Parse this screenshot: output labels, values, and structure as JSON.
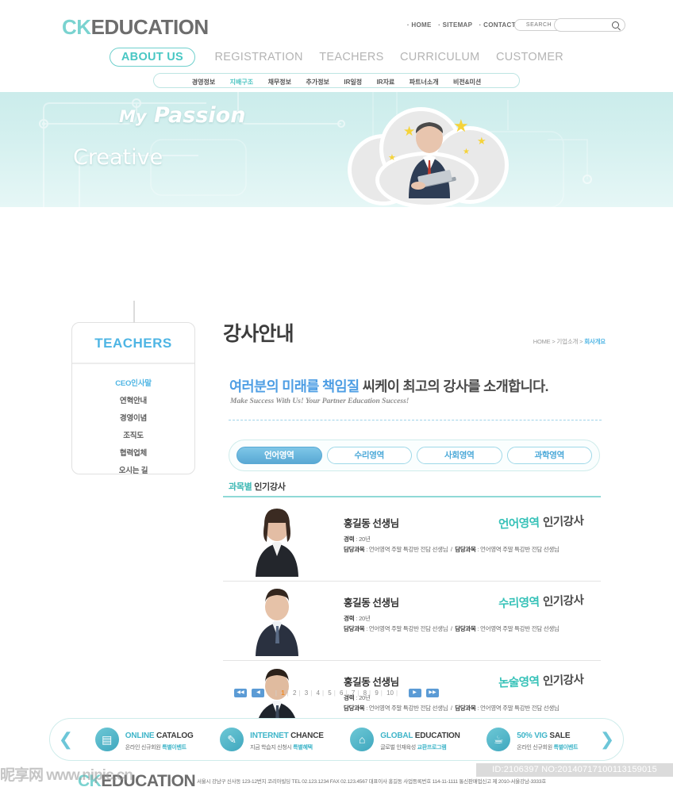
{
  "header": {
    "logo_ck": "CK",
    "logo_education": "EDUCATION",
    "top_links": [
      "· HOME",
      "· SITEMAP",
      "· CONTACT US"
    ],
    "search_button": "SEARCH",
    "search_placeholder": "",
    "search_value": "",
    "main_nav": [
      {
        "label": "ABOUT US",
        "active": true
      },
      {
        "label": "REGISTRATION",
        "active": false
      },
      {
        "label": "TEACHERS",
        "active": false
      },
      {
        "label": "CURRICULUM",
        "active": false
      },
      {
        "label": "CUSTOMER",
        "active": false
      }
    ],
    "sub_nav": [
      {
        "label": "경영정보",
        "active": false
      },
      {
        "label": "지배구조",
        "active": true
      },
      {
        "label": "채무정보",
        "active": false
      },
      {
        "label": "추가정보",
        "active": false
      },
      {
        "label": "IR일정",
        "active": false
      },
      {
        "label": "IR자료",
        "active": false
      },
      {
        "label": "파트너소개",
        "active": false
      },
      {
        "label": "비전&미션",
        "active": false
      }
    ]
  },
  "hero": {
    "line1_small": "My",
    "line1_big": "Passion",
    "line2": "Creative"
  },
  "sidebar": {
    "title": "TEACHERS",
    "items": [
      {
        "label": "CEO인사말",
        "active": true
      },
      {
        "label": "연혁안내",
        "active": false
      },
      {
        "label": "경영이념",
        "active": false
      },
      {
        "label": "조직도",
        "active": false
      },
      {
        "label": "협력업체",
        "active": false
      },
      {
        "label": "오시는 길",
        "active": false
      }
    ]
  },
  "main": {
    "page_title": "강사안내",
    "breadcrumb_home": "HOME",
    "breadcrumb_mid": "기업소개",
    "breadcrumb_current": "회사개요",
    "headline_blue": "여러분의 미래를 책임질",
    "headline_dark": "씨케이 최고의 강사를 소개합니다.",
    "subheadline": "Make Success With Us! Your Partner Education Success!",
    "tabs": [
      {
        "label": "언어영역",
        "active": true
      },
      {
        "label": "수리영역",
        "active": false
      },
      {
        "label": "사회영역",
        "active": false
      },
      {
        "label": "과학영역",
        "active": false
      }
    ],
    "section_title_teal": "과목별",
    "section_title_dark": "인기강사",
    "teachers": [
      {
        "name": "홍길동 선생님",
        "career_label": "경력",
        "career_value": "20년",
        "subject_label": "담당과목",
        "subject_value": "언어영역 주말 특강반 전담 선생님",
        "subject_label2": "담당과목",
        "subject_value2": "언어영역 주말 특강반 전담 선생님",
        "badge_area": "언어영역",
        "badge_pop": "인기강사"
      },
      {
        "name": "홍길동 선생님",
        "career_label": "경력",
        "career_value": "20년",
        "subject_label": "담당과목",
        "subject_value": "언어영역 주말 특강반 전담 선생님",
        "subject_label2": "담당과목",
        "subject_value2": "언어영역 주말 특강반 전담 선생님",
        "badge_area": "수리영역",
        "badge_pop": "인기강사"
      },
      {
        "name": "홍길동 선생님",
        "career_label": "경력",
        "career_value": "20년",
        "subject_label": "담당과목",
        "subject_value": "언어영역 주말 특강반 전담 선생님",
        "subject_label2": "담당과목",
        "subject_value2": "언어영역 주말 특강반 전담 선생님",
        "badge_area": "논술영역",
        "badge_pop": "인기강사"
      }
    ],
    "pagination": {
      "first": "◀◀",
      "prev": "◀",
      "pages": [
        "1",
        "2",
        "3",
        "4",
        "5",
        "6",
        "7",
        "8",
        "9",
        "10"
      ],
      "current": "1",
      "next": "▶",
      "last": "▶▶"
    }
  },
  "banner": {
    "prev_arrow": "❮",
    "next_arrow": "❯",
    "items": [
      {
        "icon": "catalog-icon",
        "glyph": "▤",
        "title_c1": "ONLINE",
        "title_c2": "CATALOG",
        "sub_plain": "온라인 신규회원 ",
        "sub_bold": "특별이벤트"
      },
      {
        "icon": "pencil-icon",
        "glyph": "✎",
        "title_c1": "INTERNET",
        "title_c2": "CHANCE",
        "sub_plain": "지금 학습지 신청시 ",
        "sub_bold": "특별혜택"
      },
      {
        "icon": "building-icon",
        "glyph": "⌂",
        "title_c1": "GLOBAL",
        "title_c2": "EDUCATION",
        "sub_plain": "글로벌 인재육성 ",
        "sub_bold": "교환프로그램"
      },
      {
        "icon": "cup-icon",
        "glyph": "☕",
        "title_c1": "50% VIG",
        "title_c2": "SALE",
        "sub_plain": "온라인 신규회원 ",
        "sub_bold": "특별이벤트"
      }
    ]
  },
  "footer": {
    "logo_ck": "CK",
    "logo_education": "EDUCATION",
    "address": "서울시 강남구 신사동 123-12번지 코리아빌딩  TEL 02.123.1234   FAX 02.123.4567   대표이사 홍길동 사업등록번호 114-11-1111 통신판매업신고 제 2010-서울강남-3333호"
  },
  "watermark": {
    "site": "昵享网 www.nipic.cn",
    "id_text": "ID:2106397 NO:20140717100113159015"
  }
}
